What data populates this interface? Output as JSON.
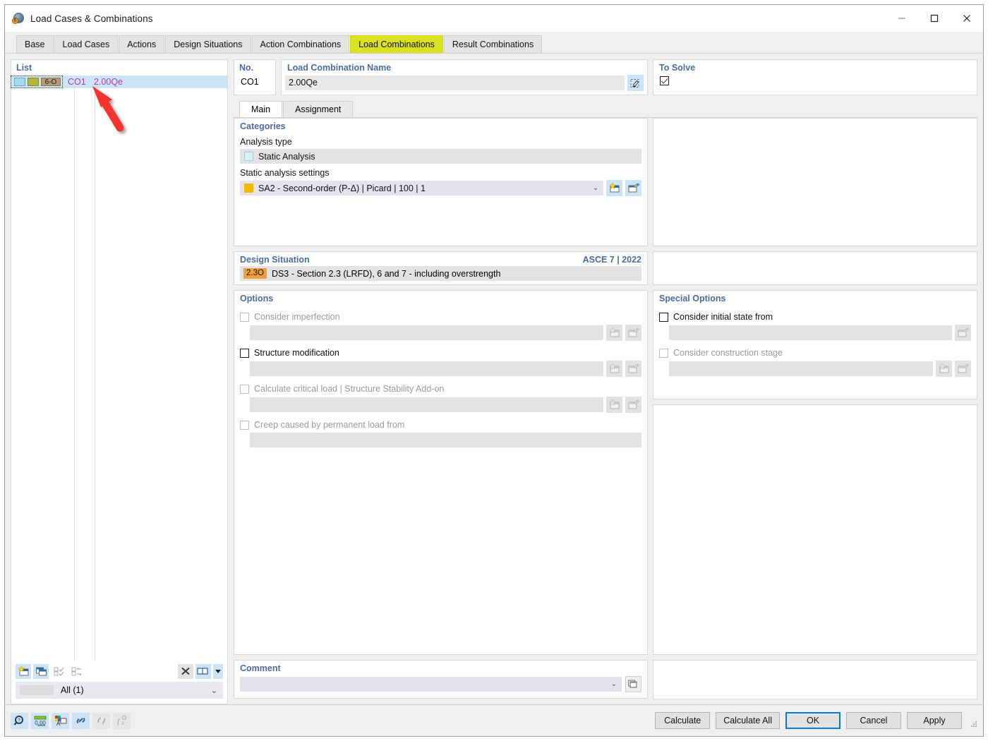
{
  "window": {
    "title": "Load Cases & Combinations",
    "icon": "app-globe-icon",
    "minimize_label": "Minimize",
    "maximize_label": "Maximize",
    "close_label": "Close"
  },
  "tabs": [
    {
      "label": "Base",
      "active": false
    },
    {
      "label": "Load Cases",
      "active": false
    },
    {
      "label": "Actions",
      "active": false
    },
    {
      "label": "Design Situations",
      "active": false
    },
    {
      "label": "Action Combinations",
      "active": false
    },
    {
      "label": "Load Combinations",
      "active": true
    },
    {
      "label": "Result Combinations",
      "active": false
    }
  ],
  "list_panel": {
    "title": "List",
    "rows": [
      {
        "swatch1_color": "#9fdcf0",
        "swatch2_color": "#b5b53a",
        "badge_text": "6-O",
        "badge_color": "#b99a74",
        "no": "CO1",
        "name": "2.00Qe"
      }
    ],
    "toolbar": [
      {
        "name": "new-combination-icon",
        "enabled": true
      },
      {
        "name": "copy-combination-icon",
        "enabled": true
      },
      {
        "name": "select-all-icon",
        "enabled": false
      },
      {
        "name": "invert-selection-icon",
        "enabled": false
      },
      {
        "name": "delete-icon",
        "enabled": true
      },
      {
        "name": "view-columns-icon",
        "enabled": true
      },
      {
        "name": "view-columns-caret-icon",
        "enabled": true
      }
    ],
    "filter": {
      "label": "All (1)",
      "caret": "chevron-down-icon"
    }
  },
  "detail": {
    "no": {
      "label": "No.",
      "value": "CO1"
    },
    "name": {
      "label": "Load Combination Name",
      "value": "2.00Qe",
      "placeholder": "",
      "edit_icon": "edit-name-icon"
    },
    "to_solve": {
      "label": "To Solve",
      "checked": true
    },
    "subtabs": [
      {
        "label": "Main",
        "active": true
      },
      {
        "label": "Assignment",
        "active": false
      }
    ],
    "categories": {
      "header": "Categories",
      "analysis_type_label": "Analysis type",
      "analysis_type_value": "Static Analysis",
      "analysis_type_color": "#d3f4f8",
      "settings_label": "Static analysis settings",
      "settings_value": "SA2 - Second-order (P-Δ) | Picard | 100 | 1",
      "settings_color": "#f5b800",
      "settings_caret": "chevron-down-icon",
      "settings_new_icon": "new-item-icon",
      "settings_edit_icon": "edit-item-icon"
    },
    "design_situation": {
      "header": "Design Situation",
      "standard": "ASCE 7 | 2022",
      "badge": "2.3O",
      "badge_color": "#f2a03c",
      "value": "DS3 - Section 2.3 (LRFD), 6 and 7 - including overstrength"
    },
    "options": {
      "header": "Options",
      "items": [
        {
          "label": "Consider imperfection",
          "checked": false,
          "enabled": false,
          "value": "",
          "buttons": [
            "new-item-icon",
            "edit-item-icon"
          ]
        },
        {
          "label": "Structure modification",
          "checked": false,
          "enabled": true,
          "value": "",
          "buttons": [
            "new-item-icon",
            "edit-item-icon"
          ]
        },
        {
          "label": "Calculate critical load | Structure Stability Add-on",
          "checked": false,
          "enabled": false,
          "value": "",
          "buttons": [
            "new-item-icon",
            "edit-item-icon"
          ]
        },
        {
          "label": "Creep caused by permanent load from",
          "checked": false,
          "enabled": false,
          "value": "",
          "buttons": []
        }
      ]
    },
    "special_options": {
      "header": "Special Options",
      "items": [
        {
          "label": "Consider initial state from",
          "checked": false,
          "enabled": true,
          "value": "",
          "buttons": [
            "edit-item-icon"
          ]
        },
        {
          "label": "Consider construction stage",
          "checked": false,
          "enabled": false,
          "value": "",
          "buttons": [
            "new-item-icon",
            "edit-item-icon"
          ]
        }
      ]
    },
    "comment": {
      "header": "Comment",
      "value": "",
      "placeholder": "",
      "caret": "chevron-down-icon",
      "copy_icon": "copy-comment-icon"
    }
  },
  "footer": {
    "tools": [
      {
        "name": "search-icon",
        "enabled": true
      },
      {
        "name": "units-icon",
        "enabled": true
      },
      {
        "name": "text-settings-icon",
        "enabled": true
      },
      {
        "name": "link-icon",
        "enabled": true
      },
      {
        "name": "unlink-icon",
        "enabled": false
      },
      {
        "name": "formula-icon",
        "enabled": false
      }
    ],
    "buttons": [
      {
        "label": "Calculate",
        "primary": false
      },
      {
        "label": "Calculate All",
        "primary": false
      },
      {
        "label": "OK",
        "primary": true
      },
      {
        "label": "Cancel",
        "primary": false
      },
      {
        "label": "Apply",
        "primary": false
      }
    ]
  },
  "annotation": {
    "arrow_color": "#f4312e",
    "name": "red-pointer-arrow"
  }
}
